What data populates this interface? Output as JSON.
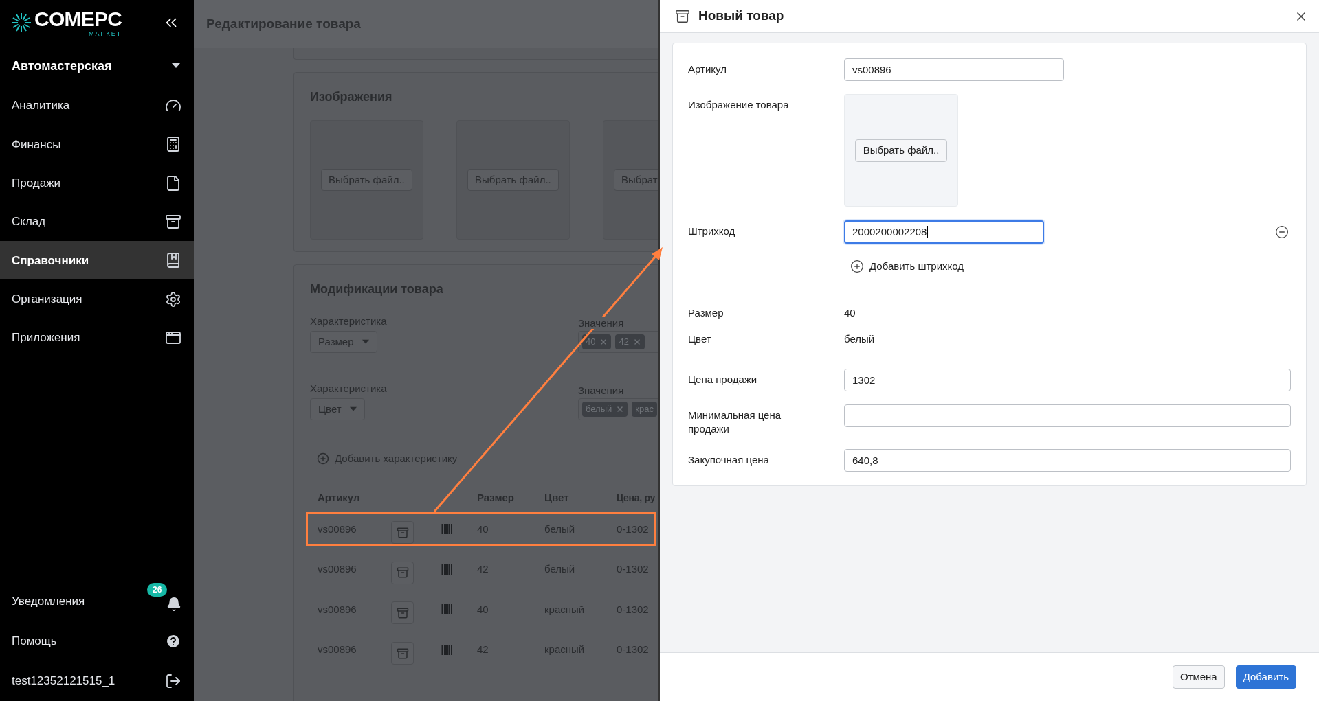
{
  "sidebar": {
    "logo": {
      "name": "COMEPC",
      "sub": "МАРКЕТ"
    },
    "org": "Автомастерская",
    "items": [
      {
        "label": "Аналитика",
        "selected": false
      },
      {
        "label": "Финансы",
        "selected": false
      },
      {
        "label": "Продажи",
        "selected": false
      },
      {
        "label": "Склад",
        "selected": false
      },
      {
        "label": "Справочники",
        "selected": true
      },
      {
        "label": "Организация",
        "selected": false
      },
      {
        "label": "Приложения",
        "selected": false
      }
    ],
    "notifications": {
      "label": "Уведомления",
      "badge": "26"
    },
    "help": "Помощь",
    "user": "test12352121515_1"
  },
  "page": {
    "title": "Редактирование товара",
    "images": {
      "title": "Изображения",
      "slots": [
        "Выбрать файл..",
        "Выбрать файл..",
        "Выбрат"
      ]
    },
    "modifications": {
      "title": "Модификации товара",
      "characteristics": [
        {
          "label": "Характеристика",
          "select": "Размер",
          "values_label": "Значения",
          "tags": [
            {
              "label": "40",
              "removable": true
            },
            {
              "label": "42",
              "removable": true
            }
          ]
        },
        {
          "label": "Характеристика",
          "select": "Цвет",
          "values_label": "Значения",
          "tags": [
            {
              "label": "белый",
              "removable": true
            },
            {
              "label": "крас",
              "removable": false
            }
          ]
        }
      ],
      "add_link": "Добавить характеристику",
      "table": {
        "columns": [
          "Артикул",
          "Размер",
          "Цвет",
          "Цена, ру"
        ],
        "rows": [
          {
            "article": "vs00896",
            "size": "40",
            "tone": "белый",
            "price": "0-1302",
            "highlighted": true
          },
          {
            "article": "vs00896",
            "size": "42",
            "tone": "белый",
            "price": "0-1302",
            "highlighted": false
          },
          {
            "article": "vs00896",
            "size": "40",
            "tone": "красный",
            "price": "0-1302",
            "highlighted": false
          },
          {
            "article": "vs00896",
            "size": "42",
            "tone": "красный",
            "price": "0-1302",
            "highlighted": false
          }
        ]
      }
    }
  },
  "dialog": {
    "title": "Новый товар",
    "fields": [
      {
        "kind": "short_input",
        "label": "Артикул",
        "value": "vs00896"
      },
      {
        "kind": "image",
        "label": "Изображение товара",
        "button": "Выбрать файл.."
      },
      {
        "kind": "barcode",
        "label": "Штрихкод",
        "value": "2000200002208",
        "focused": true,
        "add_label": "Добавить штрихкод"
      },
      {
        "kind": "text",
        "label": "Размер",
        "value": "40"
      },
      {
        "kind": "text",
        "label": "Цвет",
        "value": "белый"
      },
      {
        "kind": "input",
        "label": "Цена продажи",
        "value": "1302"
      },
      {
        "kind": "input",
        "label": "Минимальная цена продажи"
      },
      {
        "kind": "input",
        "label": "Закупочная цена",
        "value": "640,8"
      }
    ],
    "buttons": [
      {
        "label": "Отмена",
        "kind": "secondary"
      },
      {
        "label": "Добавить",
        "kind": "primary"
      }
    ]
  }
}
